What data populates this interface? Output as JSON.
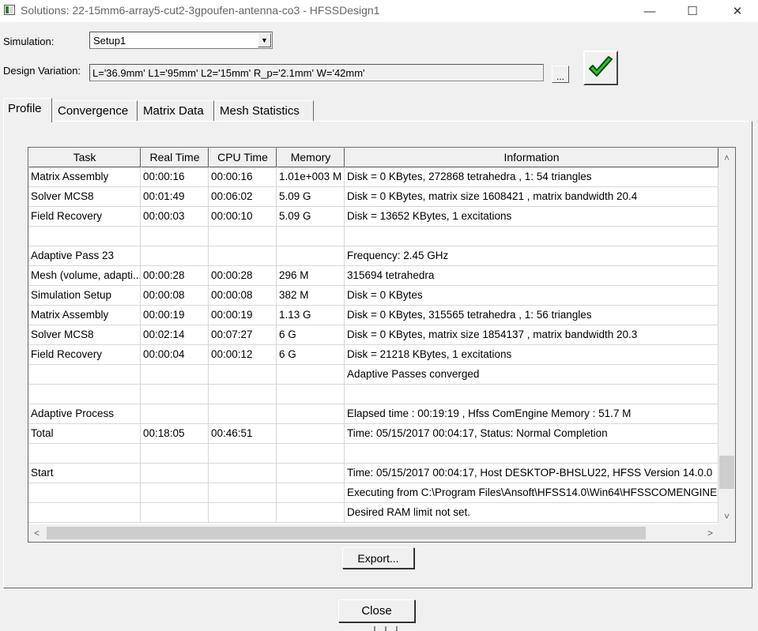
{
  "window": {
    "title": "Solutions: 22-15mm6-array5-cut2-3gpoufen-antenna-co3 - HFSSDesign1",
    "controls": {
      "minimize": "—",
      "maximize": "☐",
      "close": "✕"
    }
  },
  "simulation": {
    "label": "Simulation:",
    "value": "Setup1"
  },
  "design_variation": {
    "label": "Design Variation:",
    "value": "L='36.9mm' L1='95mm' L2='15mm' R_p='2.1mm' W='42mm'",
    "browse_label": "..."
  },
  "status_icon": "check-icon",
  "tabs": [
    "Profile",
    "Convergence",
    "Matrix Data",
    "Mesh Statistics"
  ],
  "active_tab": "Profile",
  "table": {
    "columns": [
      "Task",
      "Real Time",
      "CPU Time",
      "Memory",
      "Information"
    ],
    "rows": [
      [
        "Matrix Assembly",
        "00:00:16",
        "00:00:16",
        "1.01e+003 M",
        "Disk = 0 KBytes, 272868 tetrahedra , 1: 54 triangles"
      ],
      [
        "Solver MCS8",
        "00:01:49",
        "00:06:02",
        "5.09 G",
        "Disk = 0 KBytes, matrix size 1608421 , matrix bandwidth  20.4"
      ],
      [
        "Field Recovery",
        "00:00:03",
        "00:00:10",
        "5.09 G",
        "Disk = 13652 KBytes, 1 excitations"
      ],
      [
        "",
        "",
        "",
        "",
        ""
      ],
      [
        "Adaptive Pass 23",
        "",
        "",
        "",
        "Frequency: 2.45  GHz"
      ],
      [
        "Mesh (volume, adapti...",
        "00:00:28",
        "00:00:28",
        "296 M",
        "315694 tetrahedra"
      ],
      [
        "Simulation Setup",
        "00:00:08",
        "00:00:08",
        "382 M",
        "Disk = 0 KBytes"
      ],
      [
        "Matrix Assembly",
        "00:00:19",
        "00:00:19",
        "1.13 G",
        "Disk = 0 KBytes, 315565 tetrahedra , 1: 56 triangles"
      ],
      [
        "Solver MCS8",
        "00:02:14",
        "00:07:27",
        "6 G",
        "Disk = 0 KBytes, matrix size 1854137 , matrix bandwidth  20.3"
      ],
      [
        "Field Recovery",
        "00:00:04",
        "00:00:12",
        "6 G",
        "Disk = 21218 KBytes, 1 excitations"
      ],
      [
        "",
        "",
        "",
        "",
        "Adaptive Passes converged"
      ],
      [
        "",
        "",
        "",
        "",
        ""
      ],
      [
        "Adaptive Process",
        "",
        "",
        "",
        "Elapsed time : 00:19:19 , Hfss ComEngine Memory : 51.7 M"
      ],
      [
        "Total",
        "00:18:05",
        "00:46:51",
        "",
        "Time:  05/15/2017 00:04:17, Status: Normal Completion"
      ],
      [
        "",
        "",
        "",
        "",
        ""
      ],
      [
        "Start",
        "",
        "",
        "",
        "Time:  05/15/2017 00:04:17, Host DESKTOP-BHSLU22, HFSS Version 14.0.0"
      ],
      [
        "",
        "",
        "",
        "",
        "Executing from C:\\Program Files\\Ansoft\\HFSS14.0\\Win64\\HFSSCOMENGINE"
      ],
      [
        "",
        "",
        "",
        "",
        "Desired RAM limit not set."
      ]
    ]
  },
  "scroll_arrows": {
    "up": "˄",
    "down": "˅",
    "left": "<",
    "right": ">"
  },
  "buttons": {
    "export": "Export...",
    "close": "Close"
  }
}
